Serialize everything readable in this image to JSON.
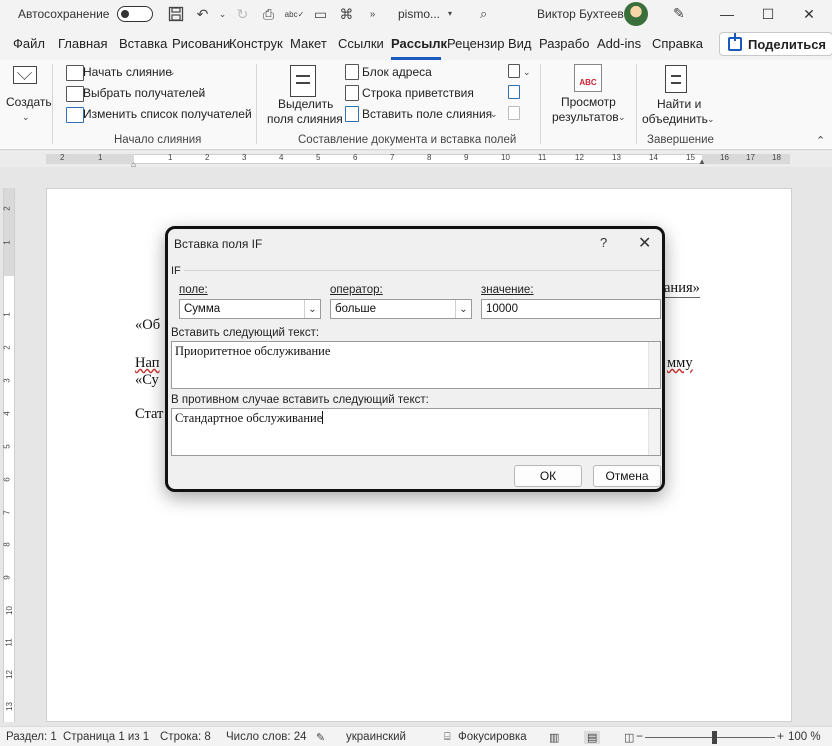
{
  "titlebar": {
    "autosave_label": "Автосохранение",
    "doc_name": "pismo...",
    "user_name": "Виктор Бухтеев"
  },
  "tabs": [
    "Файл",
    "Главная",
    "Вставка",
    "Рисовани",
    "Конструк",
    "Макет",
    "Ссылки",
    "Рассылк",
    "Рецензир",
    "Вид",
    "Разрабо",
    "Add-ins",
    "Справка"
  ],
  "active_tab": "Рассылк",
  "share_label": "Поделиться",
  "ribbon": {
    "create": {
      "label": "Создать"
    },
    "start_merge": {
      "start": "Начать слияние",
      "select": "Выбрать получателей",
      "edit": "Изменить список получателей",
      "group": "Начало слияния"
    },
    "compose": {
      "highlight_line1": "Выделить",
      "highlight_line2": "поля слияния",
      "address_block": "Блок адреса",
      "greeting_line": "Строка приветствия",
      "insert_field": "Вставить поле слияния",
      "group": "Составление документа и вставка полей"
    },
    "preview": {
      "line1": "Просмотр",
      "line2": "результатов"
    },
    "finish": {
      "line1": "Найти и",
      "line2": "объединить",
      "group": "Завершение"
    }
  },
  "ruler": {
    "h_numbers": [
      "2",
      "1",
      "1",
      "2",
      "3",
      "4",
      "5",
      "6",
      "7",
      "8",
      "9",
      "10",
      "11",
      "12",
      "13",
      "14",
      "15",
      "16",
      "17",
      "18"
    ],
    "v_numbers": [
      "2",
      "1",
      "1",
      "2",
      "3",
      "4",
      "5",
      "6",
      "7",
      "8",
      "9",
      "10",
      "11",
      "12",
      "13",
      "14",
      "15",
      "16"
    ]
  },
  "document": {
    "line_top_right": "ания»",
    "line_ob": "«Об",
    "line_nap": "Нап",
    "line_mmu": "мму",
    "line_su": "«Су",
    "line_stat": "Стат"
  },
  "dialog": {
    "title": "Вставка поля IF",
    "help": "?",
    "close": "✕",
    "section": "IF",
    "field_label": "поле:",
    "field_value": "Сумма",
    "operator_label": "оператор:",
    "operator_value": "больше",
    "value_label": "значение:",
    "value_value": "10000",
    "insert_label": "Вставить следующий текст:",
    "insert_text": "Приоритетное обслуживание",
    "else_label": "В противном случае вставить следующий текст:",
    "else_text": "Стандартное обслуживание",
    "ok": "ОК",
    "cancel": "Отмена"
  },
  "status": {
    "section": "Раздел: 1",
    "page": "Страница 1 из 1",
    "line": "Строка: 8",
    "words": "Число слов: 24",
    "language": "украинский",
    "focus": "Фокусировка",
    "zoom": "100 %"
  }
}
